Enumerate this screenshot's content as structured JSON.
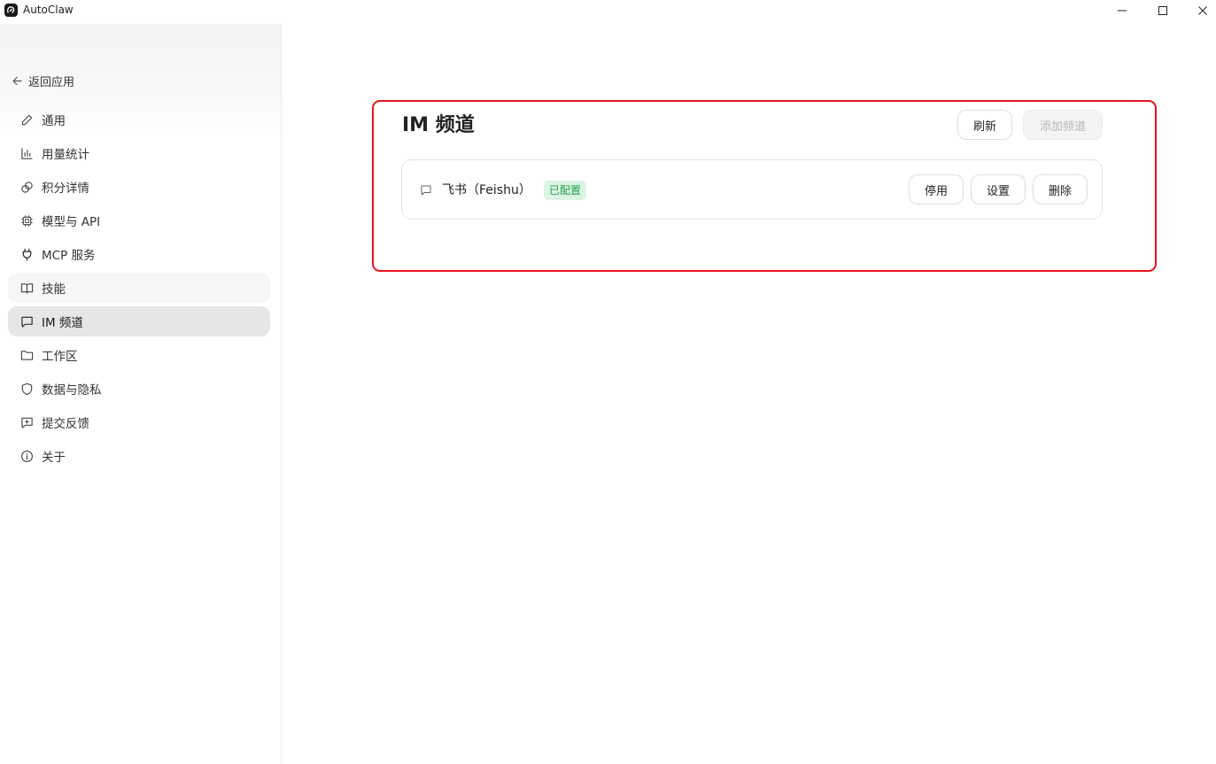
{
  "window": {
    "title": "AutoClaw"
  },
  "sidebar": {
    "back_label": "返回应用",
    "items": [
      {
        "label": "通用",
        "icon": "pencil-icon"
      },
      {
        "label": "用量统计",
        "icon": "bar-chart-icon"
      },
      {
        "label": "积分详情",
        "icon": "coins-icon"
      },
      {
        "label": "模型与 API",
        "icon": "cpu-icon"
      },
      {
        "label": "MCP 服务",
        "icon": "plug-icon"
      },
      {
        "label": "技能",
        "icon": "book-icon"
      },
      {
        "label": "IM 频道",
        "icon": "message-icon",
        "active": true
      },
      {
        "label": "工作区",
        "icon": "folder-icon"
      },
      {
        "label": "数据与隐私",
        "icon": "shield-icon"
      },
      {
        "label": "提交反馈",
        "icon": "feedback-icon"
      },
      {
        "label": "关于",
        "icon": "info-icon"
      }
    ]
  },
  "main": {
    "title": "IM 频道",
    "refresh_label": "刷新",
    "add_channel_label": "添加频道",
    "channels": [
      {
        "name": "飞书（Feishu）",
        "status": "已配置",
        "disable_label": "停用",
        "settings_label": "设置",
        "delete_label": "删除"
      }
    ]
  },
  "colors": {
    "highlight": "#e8141b",
    "badge_bg": "#dcf4e3",
    "badge_text": "#23a04e",
    "active_nav": "#e6e6e6"
  }
}
